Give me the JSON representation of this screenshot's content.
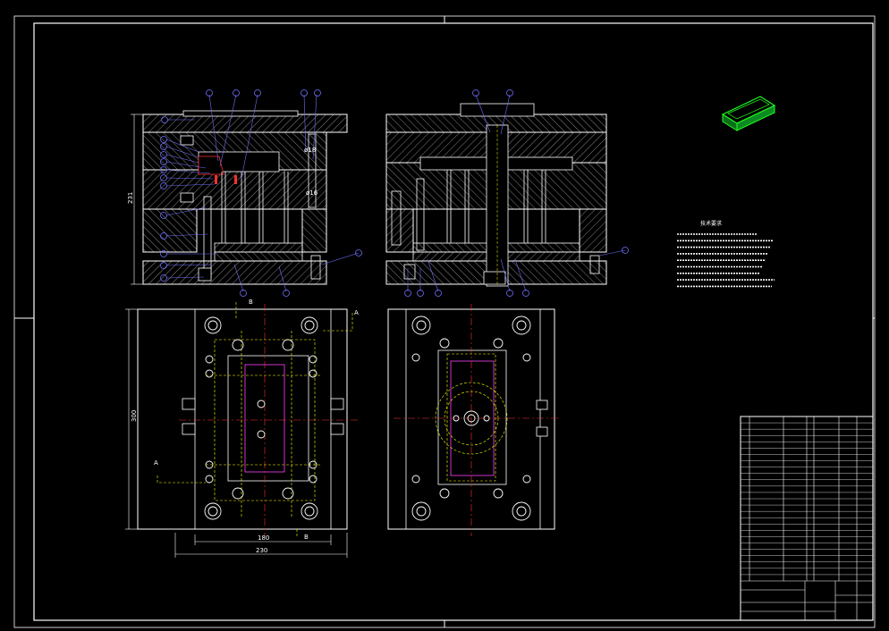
{
  "dimensions": {
    "height_side": "231",
    "height_plan": "300",
    "width_inner": "180",
    "width_outer": "230"
  },
  "section_marks": [
    "A",
    "A",
    "B",
    "B"
  ],
  "notes": {
    "title": "技术要求",
    "lines": [
      "",
      "",
      "",
      "",
      "",
      "",
      "",
      "",
      ""
    ]
  },
  "title_block": {
    "drawing_name": "",
    "rows": 25
  },
  "colors": {
    "background": "#000000",
    "line": "#ffffff",
    "center": "#ff3030",
    "hidden": "#ffff00",
    "leader": "#7070ff",
    "cyan": "#00ffff",
    "magenta": "#ff40ff",
    "hatch": "#cfcfcf",
    "iso": "#20ff20"
  }
}
